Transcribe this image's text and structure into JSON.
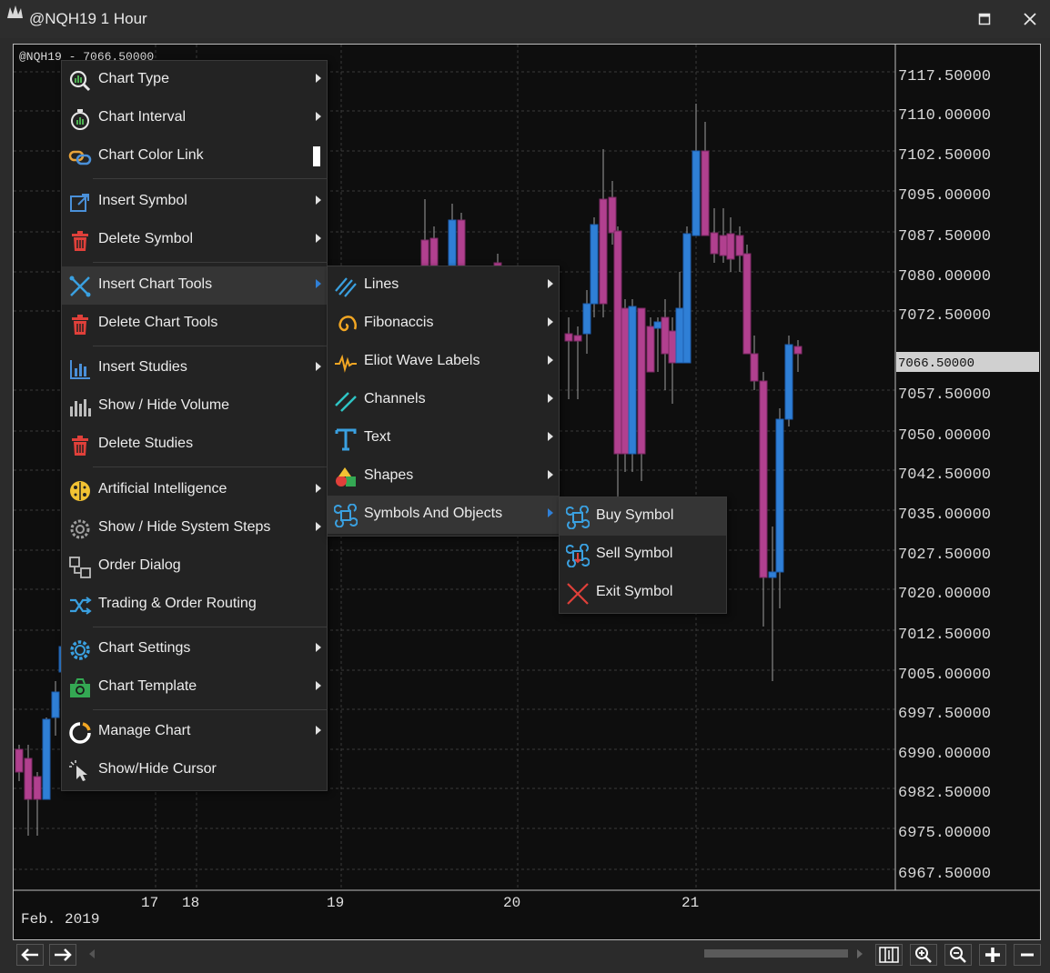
{
  "window": {
    "title": "@NQH19 1 Hour"
  },
  "chart": {
    "header_label": "@NQH19 - 7066.50000",
    "price_labels": [
      "7117.50000",
      "7110.00000",
      "7102.50000",
      "7095.00000",
      "7087.50000",
      "7080.00000",
      "7072.50000",
      "7066.50000",
      "7057.50000",
      "7050.00000",
      "7042.50000",
      "7035.00000",
      "7027.50000",
      "7020.00000",
      "7012.50000",
      "7005.00000",
      "6997.50000",
      "6990.00000",
      "6982.50000",
      "6975.00000",
      "6967.50000"
    ],
    "current_price": "7066.50000",
    "x_labels": [
      "17",
      "18",
      "19",
      "20",
      "21"
    ],
    "month_label": "Feb. 2019"
  },
  "menu": {
    "items": [
      {
        "label": "Chart Type"
      },
      {
        "label": "Chart Interval"
      },
      {
        "label": "Chart Color Link"
      },
      {
        "label": "Insert Symbol"
      },
      {
        "label": "Delete Symbol"
      },
      {
        "label": "Insert Chart Tools"
      },
      {
        "label": "Delete Chart Tools"
      },
      {
        "label": "Insert Studies"
      },
      {
        "label": "Show / Hide Volume"
      },
      {
        "label": "Delete Studies"
      },
      {
        "label": "Artificial Intelligence"
      },
      {
        "label": "Show / Hide System Steps"
      },
      {
        "label": "Order Dialog"
      },
      {
        "label": "Trading & Order Routing"
      },
      {
        "label": "Chart Settings"
      },
      {
        "label": "Chart Template"
      },
      {
        "label": "Manage Chart"
      },
      {
        "label": "Show/Hide Cursor"
      }
    ]
  },
  "submenu_tools": {
    "items": [
      {
        "label": "Lines"
      },
      {
        "label": "Fibonaccis"
      },
      {
        "label": "Eliot Wave Labels"
      },
      {
        "label": "Channels"
      },
      {
        "label": "Text"
      },
      {
        "label": "Shapes"
      },
      {
        "label": "Symbols And Objects"
      }
    ]
  },
  "submenu_symbols": {
    "items": [
      {
        "label": "Buy Symbol"
      },
      {
        "label": "Sell Symbol"
      },
      {
        "label": "Exit Symbol"
      }
    ]
  },
  "colors": {
    "up_candle": "#2f7fd6",
    "down_candle": "#b1408f",
    "accent": "#2f7fd6"
  }
}
